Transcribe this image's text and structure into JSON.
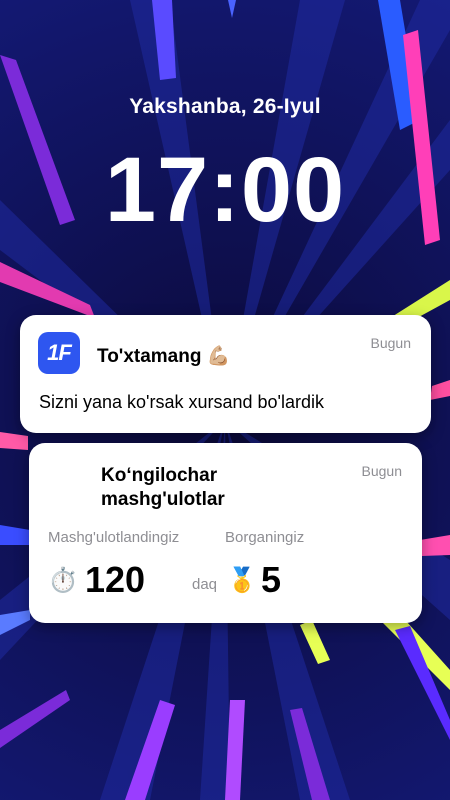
{
  "lockscreen": {
    "date": "Yakshanba, 26-Iyul",
    "time": "17:00"
  },
  "notification1": {
    "app_icon_text": "1F",
    "title": "To'xtamang 💪🏼",
    "time": "Bugun",
    "body": "Sizni yana ko'rsak xursand bo'lardik"
  },
  "notification2": {
    "title": "Ko‘ngilochar mashg'ulotlar",
    "time": "Bugun",
    "stats": [
      {
        "label": "Mashg'ulotlandingiz",
        "icon": "⏱️",
        "value": "120",
        "unit": "daq"
      },
      {
        "label": "Borganingiz",
        "icon": "🥇",
        "value": "5",
        "unit": ""
      }
    ]
  },
  "colors": {
    "background": "#0a0f4a",
    "app_icon": "#2e56f0"
  }
}
